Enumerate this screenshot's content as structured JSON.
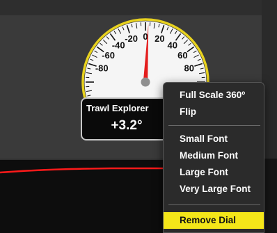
{
  "gauge": {
    "tick_labels": [
      "-80",
      "-60",
      "-40",
      "-20",
      "0",
      "20",
      "40",
      "60",
      "80"
    ],
    "needle_value": 3.2,
    "bezel_color": "#e8d21f",
    "needle_color": "#e41d1d"
  },
  "readout": {
    "title": "Trawl Explorer",
    "value": "+3.2°"
  },
  "context_menu": {
    "items": [
      "Full Scale 360º",
      "Flip",
      "Small Font",
      "Medium Font",
      "Large Font",
      "Very Large Font",
      "Remove Dial"
    ],
    "selected": "Remove Dial",
    "highlight_color": "#f4e619"
  },
  "graph": {
    "line_color": "#ff1a1a"
  }
}
